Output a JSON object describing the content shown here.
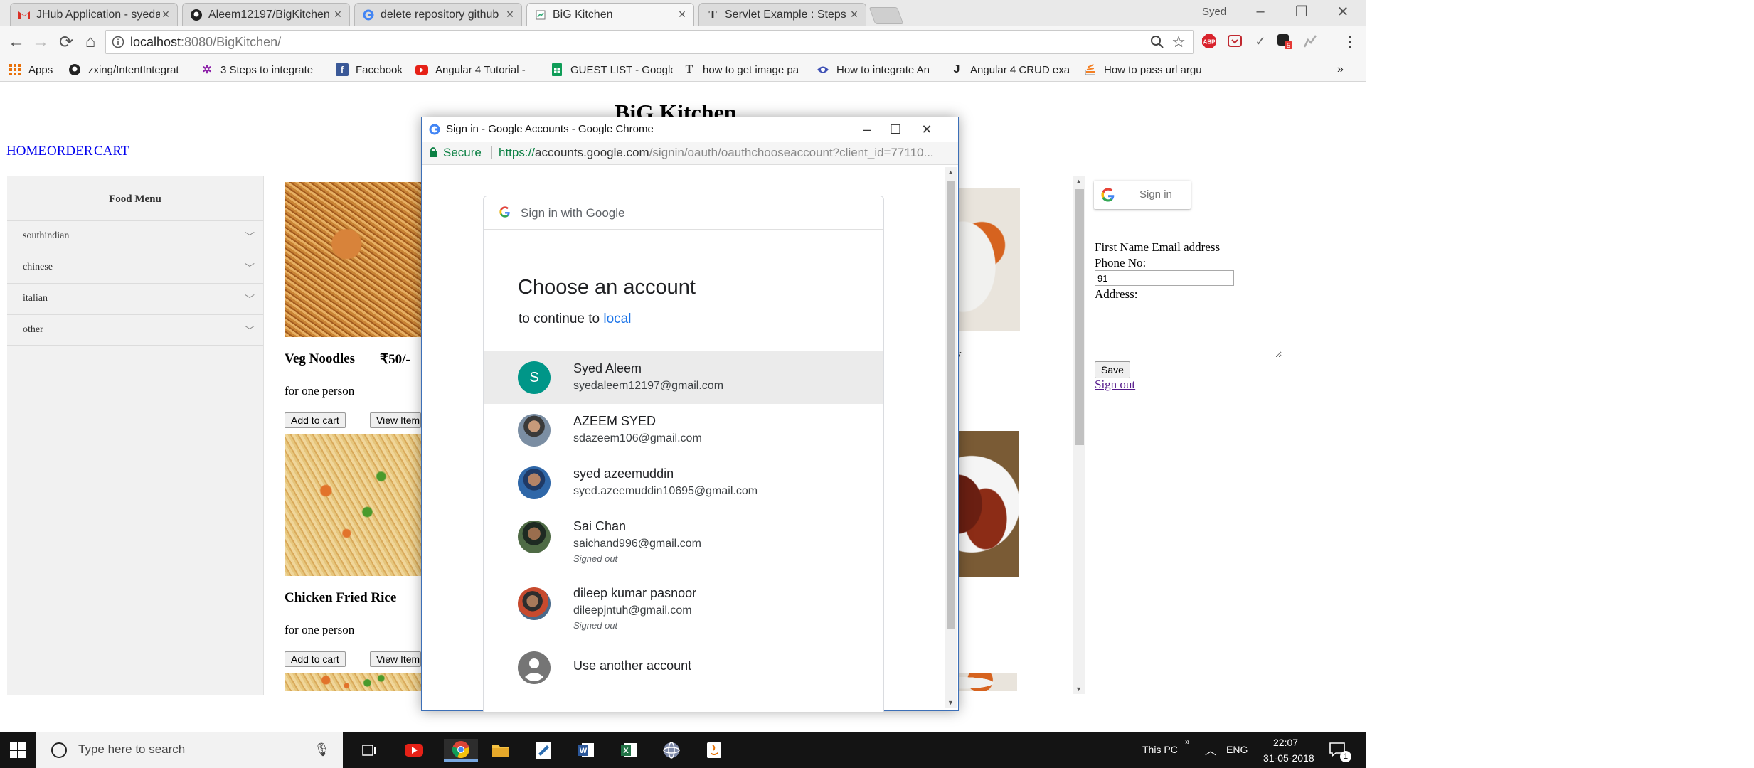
{
  "browser": {
    "tabs": [
      {
        "label": "JHub Application - syeda",
        "icon": "gmail-icon"
      },
      {
        "label": "Aleem12197/BigKitchen",
        "icon": "github-icon"
      },
      {
        "label": "delete repository github",
        "icon": "google-icon"
      },
      {
        "label": "BiG Kitchen",
        "icon": "page-icon"
      },
      {
        "label": "Servlet Example : Steps to",
        "icon": "t-icon"
      }
    ],
    "user_label": "Syed",
    "url_host": "localhost",
    "url_rest": ":8080/BigKitchen/",
    "bookmarks": [
      {
        "label": "Apps",
        "icon": "apps-icon"
      },
      {
        "label": "zxing/IntentIntegrat",
        "icon": "github-icon"
      },
      {
        "label": "3 Steps to integrate",
        "icon": "gear-icon"
      },
      {
        "label": "Facebook",
        "icon": "facebook-icon"
      },
      {
        "label": "Angular 4 Tutorial -",
        "icon": "youtube-icon"
      },
      {
        "label": "GUEST LIST - Google",
        "icon": "sheets-icon"
      },
      {
        "label": "how to get image pa",
        "icon": "t-icon"
      },
      {
        "label": "How to integrate An",
        "icon": "page-icon"
      },
      {
        "label": "Angular 4 CRUD exa",
        "icon": "j-icon"
      },
      {
        "label": "How to pass url argu",
        "icon": "stack-icon"
      }
    ],
    "bookmarks_overflow": "»",
    "abp_badge": "ABP",
    "ext_badge": "5"
  },
  "page": {
    "title": "BiG Kitchen",
    "nav": [
      "HOME",
      "ORDER",
      "CART"
    ],
    "menu_title": "Food Menu",
    "menu_items": [
      "southindian",
      "chinese",
      "italian",
      "other"
    ],
    "foods": [
      {
        "name": "Veg Noodles",
        "price": "₹50/-",
        "desc": "for one person"
      },
      {
        "name": "Chicken Fried Rice",
        "desc": "for one person"
      }
    ],
    "add_to_cart": "Add to cart",
    "view_item": "View Item",
    "partial_text": "y"
  },
  "form": {
    "signin_label": "Sign in",
    "first_name_label": "First Name Email address",
    "phone_label": "Phone No:",
    "phone_value": "91",
    "address_label": "Address:",
    "save_label": "Save",
    "signout_label": "Sign out"
  },
  "popup": {
    "window_title": "Sign in - Google Accounts - Google Chrome",
    "secure_label": "Secure",
    "url_scheme": "https://",
    "url_domain": "accounts.google.com",
    "url_path": "/signin/oauth/oauthchooseaccount?client_id=77110...",
    "card_header": "Sign in with Google",
    "heading": "Choose an account",
    "continue_prefix": "to continue to",
    "continue_target": "local",
    "accounts": [
      {
        "name": "Syed Aleem",
        "email": "syedaleem12197@gmail.com",
        "status": "",
        "initial": "S"
      },
      {
        "name": "AZEEM SYED",
        "email": "sdazeem106@gmail.com",
        "status": ""
      },
      {
        "name": "syed azeemuddin",
        "email": "syed.azeemuddin10695@gmail.com",
        "status": ""
      },
      {
        "name": "Sai Chan",
        "email": "saichand996@gmail.com",
        "status": "Signed out"
      },
      {
        "name": "dileep kumar pasnoor",
        "email": "dileepjntuh@gmail.com",
        "status": "Signed out"
      }
    ],
    "use_another": "Use another account"
  },
  "taskbar": {
    "search_placeholder": "Type here to search",
    "this_pc": "This PC",
    "lang": "ENG",
    "time": "22:07",
    "date": "31-05-2018",
    "notif_count": "1"
  }
}
